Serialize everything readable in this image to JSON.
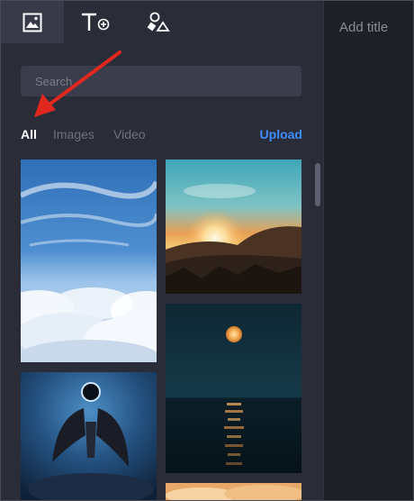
{
  "header": {
    "add_title_placeholder": "Add title"
  },
  "tabs": [
    {
      "name": "images-tab",
      "icon": "image-icon",
      "active": true
    },
    {
      "name": "text-tab",
      "icon": "text-add-icon",
      "active": false
    },
    {
      "name": "shapes-tab",
      "icon": "shapes-icon",
      "active": false
    }
  ],
  "search": {
    "placeholder": "Search",
    "value": ""
  },
  "filters": {
    "all": "All",
    "images": "Images",
    "video": "Video",
    "upload": "Upload"
  },
  "colors": {
    "panel_bg": "#2a2c38",
    "accent": "#3d8eff",
    "annotation_arrow": "#e0281f"
  },
  "media": [
    {
      "name": "sky-clouds-image",
      "depicts": "blue sky above clouds"
    },
    {
      "name": "sunset-hills-image",
      "depicts": "sunset over hills"
    },
    {
      "name": "moon-ocean-image",
      "depicts": "full moon over ocean"
    },
    {
      "name": "dark-wings-image",
      "depicts": "winged figure with eclipse"
    },
    {
      "name": "sunset-clouds-image",
      "depicts": "orange clouds (partially visible)"
    }
  ]
}
